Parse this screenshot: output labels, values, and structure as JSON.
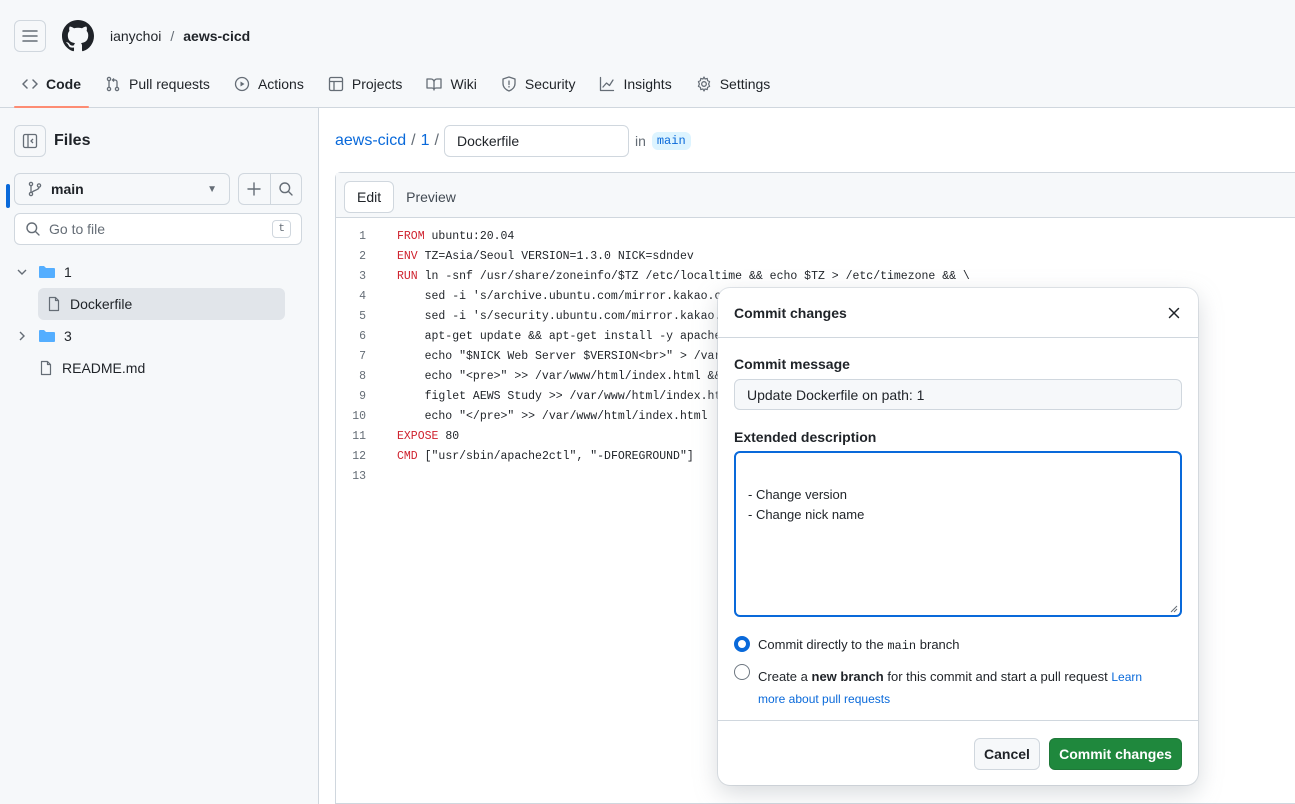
{
  "header": {
    "owner": "ianychoi",
    "separator": "/",
    "repo": "aews-cicd",
    "tabs": [
      {
        "label": "Code",
        "icon": "code-icon"
      },
      {
        "label": "Pull requests",
        "icon": "git-pull-request-icon"
      },
      {
        "label": "Actions",
        "icon": "play-icon"
      },
      {
        "label": "Projects",
        "icon": "table-icon"
      },
      {
        "label": "Wiki",
        "icon": "book-icon"
      },
      {
        "label": "Security",
        "icon": "shield-icon"
      },
      {
        "label": "Insights",
        "icon": "graph-icon"
      },
      {
        "label": "Settings",
        "icon": "gear-icon"
      }
    ]
  },
  "sidebar": {
    "title": "Files",
    "branch": "main",
    "goto_placeholder": "Go to file",
    "goto_shortcut": "t",
    "tree": [
      {
        "name": "1",
        "type": "folder",
        "expanded": true
      },
      {
        "name": "Dockerfile",
        "type": "file",
        "selected": true
      },
      {
        "name": "3",
        "type": "folder",
        "expanded": false
      },
      {
        "name": "README.md",
        "type": "file"
      }
    ]
  },
  "editor": {
    "path_repo": "aews-cicd",
    "path_dir": "1",
    "filename": "Dockerfile",
    "in_label": "in",
    "branch": "main",
    "tab_edit": "Edit",
    "tab_preview": "Preview",
    "lines": [
      {
        "n": "1",
        "kw": "FROM",
        "rest": " ubuntu:20.04"
      },
      {
        "n": "2",
        "kw": "ENV",
        "rest": " TZ=Asia/Seoul VERSION=1.3.0 NICK=sdndev"
      },
      {
        "n": "3",
        "kw": "RUN",
        "rest": " ln -snf /usr/share/zoneinfo/$TZ /etc/localtime && echo $TZ > /etc/timezone && \\"
      },
      {
        "n": "4",
        "kw": "",
        "rest": "    sed -i 's/archive.ubuntu.com/mirror.kakao.com"
      },
      {
        "n": "5",
        "kw": "",
        "rest": "    sed -i 's/security.ubuntu.com/mirror.kakao.co"
      },
      {
        "n": "6",
        "kw": "",
        "rest": "    apt-get update && apt-get install -y apache2"
      },
      {
        "n": "7",
        "kw": "",
        "rest": "    echo \"$NICK Web Server $VERSION<br>\" > /var/w"
      },
      {
        "n": "8",
        "kw": "",
        "rest": "    echo \"<pre>\" >> /var/www/html/index.html && \\"
      },
      {
        "n": "9",
        "kw": "",
        "rest": "    figlet AEWS Study >> /var/www/html/index.html"
      },
      {
        "n": "10",
        "kw": "",
        "rest": "    echo \"</pre>\" >> /var/www/html/index.html"
      },
      {
        "n": "11",
        "kw": "EXPOSE",
        "rest": " 80"
      },
      {
        "n": "12",
        "kw": "CMD",
        "rest": " [\"usr/sbin/apache2ctl\", \"-DFOREGROUND\"]"
      },
      {
        "n": "13",
        "kw": "",
        "rest": ""
      }
    ]
  },
  "modal": {
    "title": "Commit changes",
    "message_label": "Commit message",
    "message_value": "Update Dockerfile on path: 1",
    "description_label": "Extended description",
    "description_value": "- Change version\n- Change nick name",
    "option1_prefix": "Commit directly to the",
    "option1_branch": "main",
    "option1_suffix": "branch",
    "option2_prefix": "Create a",
    "option2_bold": "new branch",
    "option2_suffix": "for this commit and start a pull request",
    "option2_link1": "Learn",
    "option2_link2": "more about pull requests",
    "cancel_label": "Cancel",
    "commit_label": "Commit changes"
  },
  "colors": {
    "accent": "#0969da",
    "primary_button": "#1f883d",
    "tab_underline": "#fd8c73"
  }
}
